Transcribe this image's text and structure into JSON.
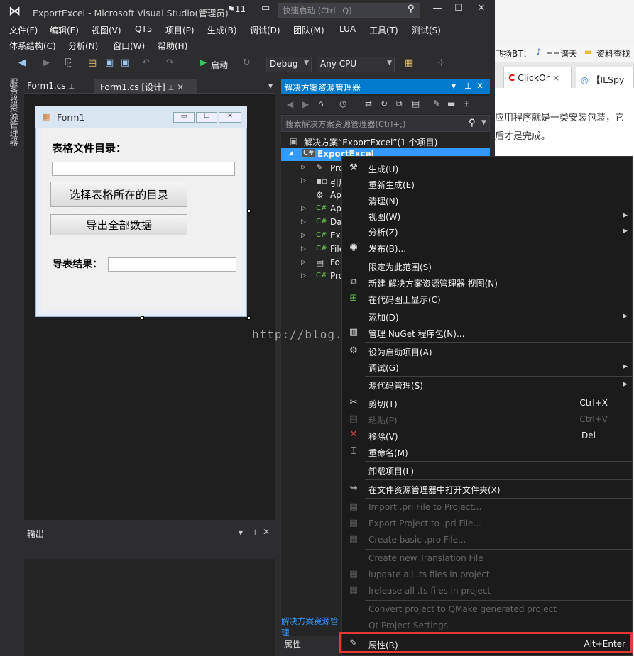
{
  "window": {
    "title": "ExportExcel - Microsoft Visual Studio(管理员)",
    "notifications": "11",
    "quick_launch_placeholder": "快速启动 (Ctrl+Q)"
  },
  "menu_row1": [
    "文件(F)",
    "编辑(E)",
    "视图(V)",
    "QT5",
    "项目(P)",
    "生成(B)",
    "调试(D)",
    "团队(M)",
    "LUA",
    "工具(T)",
    "测试(S)"
  ],
  "menu_row2": [
    "体系结构(C)",
    "分析(N)",
    "窗口(W)",
    "帮助(H)"
  ],
  "toolbar": {
    "start_label": "启动",
    "config": "Debug",
    "platform": "Any CPU"
  },
  "left_strip": {
    "server_explorer": "服务器资源管理器"
  },
  "doc_tabs": [
    {
      "label": "Form1.cs"
    },
    {
      "label": "Form1.cs [设计]"
    }
  ],
  "form1": {
    "title": "Form1",
    "label_dir": "表格文件目录：",
    "btn_select": "选择表格所在的目录",
    "btn_export": "导出全部数据",
    "label_result": "导表结果："
  },
  "output": {
    "title": "输出"
  },
  "solution_explorer": {
    "title": "解决方案资源管理器",
    "search_placeholder": "搜索解决方案资源管理器(Ctrl+;)",
    "solution": "解决方案“ExportExcel”(1 个项目)",
    "project": "ExportExcel",
    "items": [
      "Pro",
      "引用",
      "Ap",
      "Ap",
      "Da",
      "Exc",
      "File",
      "For",
      "Pro"
    ],
    "bottom_tab": "解决方案资源管理",
    "properties": "属性"
  },
  "context_menu": {
    "items": [
      {
        "label": "生成(U)"
      },
      {
        "label": "重新生成(E)"
      },
      {
        "label": "清理(N)"
      },
      {
        "label": "视图(W)"
      },
      {
        "label": "分析(Z)"
      },
      {
        "label": "发布(B)..."
      },
      {
        "label": "限定为此范围(S)"
      },
      {
        "label": "新建 解决方案资源管理器 视图(N)"
      },
      {
        "label": "在代码图上显示(C)"
      },
      {
        "label": "添加(D)"
      },
      {
        "label": "管理 NuGet 程序包(N)..."
      },
      {
        "label": "设为启动项目(A)"
      },
      {
        "label": "调试(G)"
      },
      {
        "label": "源代码管理(S)"
      },
      {
        "label": "剪切(T)",
        "shortcut": "Ctrl+X"
      },
      {
        "label": "粘贴(P)",
        "shortcut": "Ctrl+V"
      },
      {
        "label": "移除(V)",
        "shortcut": "Del"
      },
      {
        "label": "重命名(M)"
      },
      {
        "label": "卸载项目(L)"
      },
      {
        "label": "在文件资源管理器中打开文件夹(X)"
      },
      {
        "label": "Import .pri File to Project..."
      },
      {
        "label": "Export Project to .pri File..."
      },
      {
        "label": "Create basic .pro File..."
      },
      {
        "label": "Create new Translation File"
      },
      {
        "label": "lupdate all .ts files in project"
      },
      {
        "label": "lrelease all .ts files in project"
      },
      {
        "label": "Convert project to QMake generated project"
      },
      {
        "label": "Qt Project Settings"
      },
      {
        "label": "属性(R)",
        "shortcut": "Alt+Enter"
      }
    ]
  },
  "browser": {
    "bookmark1": "飞扬BT：",
    "bookmark2": "==谱天",
    "bookmark3": "资料查找",
    "tab1": "ClickOr",
    "tab2": "【ILSpy",
    "text1": "应用程序就是一类安装包装，它",
    "text2": "后才是完成。"
  },
  "watermark": "http://blog.csdn.net/"
}
